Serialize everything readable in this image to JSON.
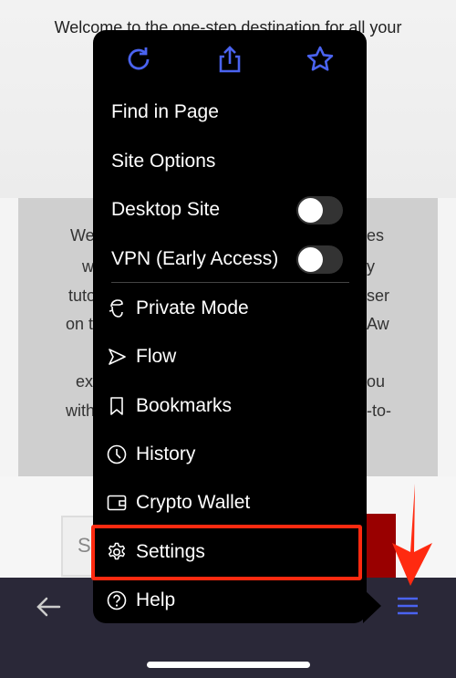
{
  "page": {
    "welcome_text": "Welcome to the one-step destination for all your",
    "left_fragments": [
      "We",
      "w",
      "tuto",
      "on t",
      "ex",
      "with"
    ],
    "right_fragments": [
      "es",
      "y",
      "ser",
      "Aw",
      "ou",
      "-to-"
    ],
    "search_placeholder_fragment": "S"
  },
  "menu": {
    "top_icons": [
      "reload-icon",
      "share-icon",
      "star-icon"
    ],
    "items": [
      {
        "label": "Find in Page"
      },
      {
        "label": "Site Options"
      },
      {
        "label": "Desktop Site",
        "toggle": false
      },
      {
        "label": "VPN (Early Access)",
        "toggle": false
      },
      {
        "label": "Private Mode",
        "icon": "private-mode-icon"
      },
      {
        "label": "Flow",
        "icon": "send-icon"
      },
      {
        "label": "Bookmarks",
        "icon": "bookmark-icon"
      },
      {
        "label": "History",
        "icon": "clock-icon"
      },
      {
        "label": "Crypto Wallet",
        "icon": "wallet-icon"
      },
      {
        "label": "Settings",
        "icon": "gear-icon",
        "highlighted": true
      },
      {
        "label": "Help",
        "icon": "help-icon"
      }
    ]
  },
  "colors": {
    "accent": "#4a63f0",
    "highlight": "#ff2a10",
    "toolbar": "#2a2838"
  }
}
